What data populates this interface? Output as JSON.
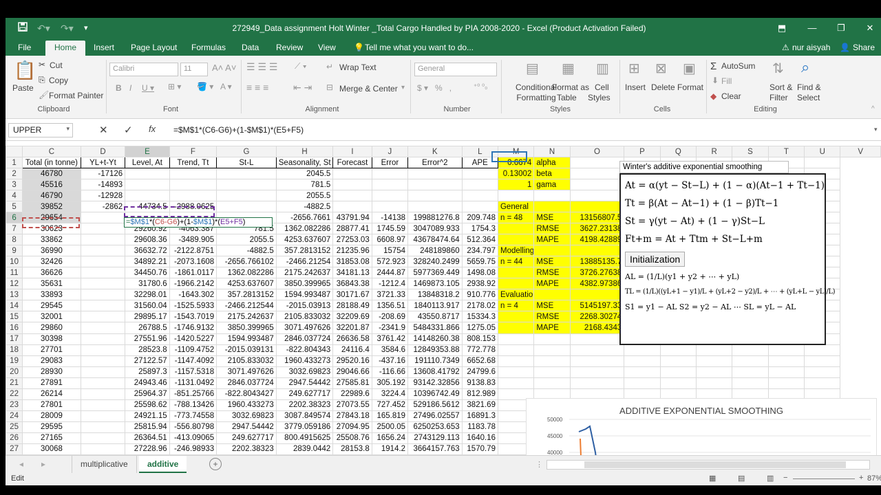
{
  "title": "272949_Data assignment Holt Winter _Total Cargo Handled by PIA 2008-2020 - Excel (Product Activation Failed)",
  "user": "nur aisyah",
  "share": "Share",
  "tabs": [
    "File",
    "Home",
    "Insert",
    "Page Layout",
    "Formulas",
    "Data",
    "Review",
    "View"
  ],
  "tell_me": "Tell me what you want to do...",
  "ribbon": {
    "paste": "Paste",
    "cut": "Cut",
    "copy": "Copy",
    "format_painter": "Format Painter",
    "clipboard": "Clipboard",
    "font_name": "Calibri",
    "font_size": "11",
    "font": "Font",
    "wrap_text": "Wrap Text",
    "merge_center": "Merge & Center",
    "alignment": "Alignment",
    "number_format": "General",
    "number": "Number",
    "conditional": "Conditional",
    "formatting": "Formatting",
    "format_as": "Format as",
    "table": "Table",
    "cell": "Cell",
    "styles_btn": "Styles",
    "styles": "Styles",
    "insert": "Insert",
    "delete": "Delete",
    "format": "Format",
    "cells": "Cells",
    "autosum": "AutoSum",
    "fill": "Fill",
    "clear": "Clear",
    "sort_filter": "Sort &",
    "filter": "Filter",
    "find_select": "Find &",
    "select": "Select",
    "editing": "Editing"
  },
  "namebox": "UPPER",
  "formula": "=$M$1*(C6-G6)+(1-$M$1)*(E5+F5)",
  "edit_formula": {
    "p1": "=",
    "p2": "$M$1",
    "p3": "*(",
    "p4": "C6-G6",
    "p5": ")+(1-",
    "p6": "$M$1",
    "p7": ")*(",
    "p8": "E5+F5",
    "p9": ")"
  },
  "columns": [
    "C",
    "D",
    "E",
    "F",
    "G",
    "H",
    "I",
    "J",
    "K",
    "L",
    "M",
    "N",
    "O",
    "P",
    "Q",
    "R",
    "S",
    "T",
    "U",
    "V"
  ],
  "rows": [
    [
      "1",
      "Total (in tonne)",
      "YL+t-Yt",
      "Level, At",
      "Trend, Tt",
      "St-L",
      "Seasonality, St",
      "Forecast",
      "Error",
      "Error^2",
      "APE",
      "0.6674",
      "alpha",
      "",
      "",
      "",
      "",
      "",
      "",
      ""
    ],
    [
      "2",
      "46780",
      "-17126",
      "",
      "",
      "",
      "2045.5",
      "",
      "",
      "",
      "",
      "0.13002",
      "beta",
      "",
      "",
      "",
      "",
      "",
      "",
      ""
    ],
    [
      "3",
      "45516",
      "-14893",
      "",
      "",
      "",
      "781.5",
      "",
      "",
      "",
      "",
      "1",
      "gama",
      "",
      "",
      "",
      "",
      "",
      "",
      ""
    ],
    [
      "4",
      "46790",
      "-12928",
      "",
      "",
      "",
      "2055.5",
      "",
      "",
      "",
      "",
      "",
      "",
      "",
      "",
      "",
      "",
      "",
      "",
      ""
    ],
    [
      "5",
      "39852",
      "-2862",
      "44734.5",
      "-2988.0625",
      "",
      "-4882.5",
      "",
      "",
      "",
      "",
      "General",
      "",
      "",
      "",
      "",
      "",
      "",
      "",
      ""
    ],
    [
      "6",
      "29654",
      "",
      "",
      "",
      "",
      "-2656.7661",
      "43791.94",
      "-14138",
      "199881276.8",
      "209.748",
      "n = 48",
      "MSE",
      "13156807.5",
      "",
      "",
      "",
      "",
      "",
      ""
    ],
    [
      "7",
      "30623",
      "",
      "29260.92",
      "-4063.387",
      "781.5",
      "1362.082286",
      "28877.41",
      "1745.59",
      "3047089.933",
      "1754.3",
      "",
      "RMSE",
      "3627.23138",
      "",
      "",
      "",
      "",
      "",
      ""
    ],
    [
      "8",
      "33862",
      "",
      "29608.36",
      "-3489.905",
      "2055.5",
      "4253.637607",
      "27253.03",
      "6608.97",
      "43678474.64",
      "512.364",
      "",
      "MAPE",
      "4198.42889",
      "",
      "",
      "",
      "",
      "",
      ""
    ],
    [
      "9",
      "36990",
      "",
      "36632.72",
      "-2122.8751",
      "-4882.5",
      "357.2813152",
      "21235.96",
      "15754",
      "248189860",
      "234.797",
      "Modelling",
      "",
      "",
      "",
      "",
      "",
      "",
      "",
      ""
    ],
    [
      "10",
      "32426",
      "",
      "34892.21",
      "-2073.1608",
      "-2656.766102",
      "-2466.21254",
      "31853.08",
      "572.923",
      "328240.2499",
      "5659.75",
      "n = 44",
      "MSE",
      "13885135.7",
      "",
      "",
      "",
      "",
      "",
      ""
    ],
    [
      "11",
      "36626",
      "",
      "34450.76",
      "-1861.0117",
      "1362.082286",
      "2175.242637",
      "34181.13",
      "2444.87",
      "5977369.449",
      "1498.08",
      "",
      "RMSE",
      "3726.27638",
      "",
      "",
      "",
      "",
      "",
      ""
    ],
    [
      "12",
      "35631",
      "",
      "31780.6",
      "-1966.2142",
      "4253.637607",
      "3850.399965",
      "36843.38",
      "-1212.4",
      "1469873.105",
      "2938.92",
      "",
      "MAPE",
      "4382.97386",
      "",
      "",
      "",
      "",
      "",
      ""
    ],
    [
      "13",
      "33893",
      "",
      "32298.01",
      "-1643.302",
      "357.2813152",
      "1594.993487",
      "30171.67",
      "3721.33",
      "13848318.2",
      "910.776",
      "Evaluation",
      "",
      "",
      "",
      "",
      "",
      "",
      "",
      ""
    ],
    [
      "14",
      "29545",
      "",
      "31560.04",
      "-1525.5933",
      "-2466.212544",
      "-2015.03913",
      "28188.49",
      "1356.51",
      "1840113.917",
      "2178.02",
      "n = 4",
      "MSE",
      "5145197.33",
      "",
      "",
      "",
      "",
      "",
      ""
    ],
    [
      "15",
      "32001",
      "",
      "29895.17",
      "-1543.7019",
      "2175.242637",
      "2105.833032",
      "32209.69",
      "-208.69",
      "43550.8717",
      "15334.3",
      "",
      "RMSE",
      "2268.30274",
      "",
      "",
      "",
      "",
      "",
      ""
    ],
    [
      "16",
      "29860",
      "",
      "26788.5",
      "-1746.9132",
      "3850.399965",
      "3071.497626",
      "32201.87",
      "-2341.9",
      "5484331.866",
      "1275.05",
      "",
      "MAPE",
      "2168.4343",
      "",
      "",
      "",
      "",
      "",
      ""
    ],
    [
      "17",
      "30398",
      "",
      "27551.96",
      "-1420.5227",
      "1594.993487",
      "2846.037724",
      "26636.58",
      "3761.42",
      "14148260.38",
      "808.153",
      "",
      "",
      "",
      "",
      "",
      "",
      "",
      "",
      ""
    ],
    [
      "18",
      "27701",
      "",
      "28523.8",
      "-1109.4752",
      "-2015.039131",
      "-822.804343",
      "24116.4",
      "3584.6",
      "12849353.88",
      "772.778",
      "",
      "",
      "",
      "",
      "",
      "",
      "",
      "",
      ""
    ],
    [
      "19",
      "29083",
      "",
      "27122.57",
      "-1147.4092",
      "2105.833032",
      "1960.433273",
      "29520.16",
      "-437.16",
      "191110.7349",
      "6652.68",
      "",
      "",
      "",
      "",
      "",
      "",
      "",
      "",
      ""
    ],
    [
      "20",
      "28930",
      "",
      "25897.3",
      "-1157.5318",
      "3071.497626",
      "3032.69823",
      "29046.66",
      "-116.66",
      "13608.41792",
      "24799.6",
      "",
      "",
      "",
      "",
      "",
      "",
      "",
      "",
      ""
    ],
    [
      "21",
      "27891",
      "",
      "24943.46",
      "-1131.0492",
      "2846.037724",
      "2947.54442",
      "27585.81",
      "305.192",
      "93142.32856",
      "9138.83",
      "",
      "",
      "",
      "",
      "",
      "",
      "",
      "",
      ""
    ],
    [
      "22",
      "26214",
      "",
      "25964.37",
      "-851.25766",
      "-822.8043427",
      "249.627717",
      "22989.6",
      "3224.4",
      "10396742.49",
      "812.989",
      "",
      "",
      "",
      "",
      "",
      "",
      "",
      "",
      ""
    ],
    [
      "23",
      "27801",
      "",
      "25598.62",
      "-788.13426",
      "1960.433273",
      "2202.38323",
      "27073.55",
      "727.452",
      "529186.5612",
      "3821.69",
      "",
      "",
      "",
      "",
      "",
      "",
      "",
      "",
      ""
    ],
    [
      "24",
      "28009",
      "",
      "24921.15",
      "-773.74558",
      "3032.69823",
      "3087.849574",
      "27843.18",
      "165.819",
      "27496.02557",
      "16891.3",
      "",
      "",
      "",
      "",
      "",
      "",
      "",
      "",
      ""
    ],
    [
      "25",
      "29595",
      "",
      "25815.94",
      "-556.80798",
      "2947.54442",
      "3779.059186",
      "27094.95",
      "2500.05",
      "6250253.653",
      "1183.78",
      "",
      "",
      "",
      "",
      "",
      "",
      "",
      "",
      ""
    ],
    [
      "26",
      "27165",
      "",
      "26364.51",
      "-413.09065",
      "249.627717",
      "800.4915625",
      "25508.76",
      "1656.24",
      "2743129.113",
      "1640.16",
      "",
      "",
      "",
      "",
      "",
      "",
      "",
      "",
      ""
    ],
    [
      "27",
      "30068",
      "",
      "27228.96",
      "-246.98933",
      "2202.38323",
      "2839.0442",
      "28153.8",
      "1914.2",
      "3664157.763",
      "1570.79",
      "",
      "",
      "",
      "",
      "",
      "",
      "",
      "",
      ""
    ]
  ],
  "formula_box": {
    "title": "Winter's additive exponential smoothing",
    "eq1": "At = α(yt − St−L) + (1 − α)(At−1 + Tt−1)",
    "eq2": "Tt = β(At − At−1) + (1 − β)Tt−1",
    "eq3": "St = γ(yt − At) + (1 − γ)St−L",
    "eq4": "Ft+m = At + Ttm + St−L+m",
    "init": "Initialization",
    "eq5": "AL = (1/L)(y1 + y2 + ⋯ + yL)",
    "eq6": "TL = (1/L)((yL+1 − y1)/L + (yL+2 − y2)/L + ⋯ + (yL+L − yL)/L)",
    "eq7": "S1 = y1 − AL    S2 = y2 − AL   ⋯   SL = yL − AL"
  },
  "chart": {
    "title": "ADDITIVE EXPONENTIAL SMOOTHING",
    "ticks": [
      "50000",
      "45000",
      "40000"
    ]
  },
  "sheets": [
    "multiplicative",
    "additive"
  ],
  "status": "Edit",
  "zoom": "87%",
  "colors": {
    "excel_green": "#217346",
    "highlight": "#ffff00",
    "selected_header": "#d2d2d2"
  }
}
